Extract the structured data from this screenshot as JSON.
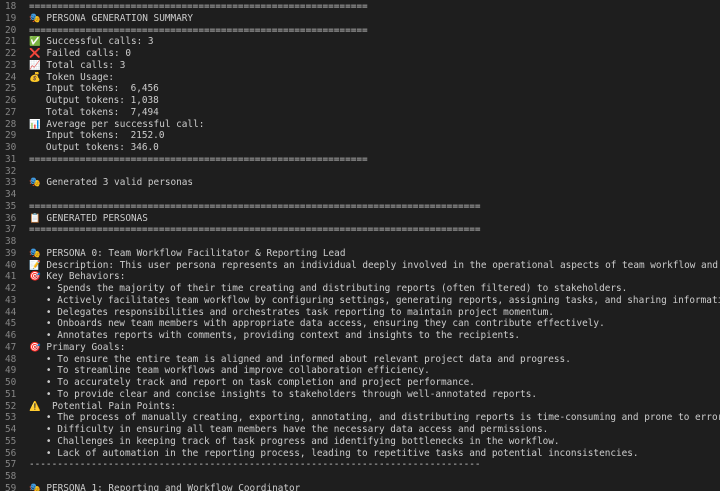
{
  "lines": [
    {
      "n": "18",
      "t": "============================================================"
    },
    {
      "n": "19",
      "t": "🎭 PERSONA GENERATION SUMMARY"
    },
    {
      "n": "20",
      "t": "============================================================"
    },
    {
      "n": "21",
      "t": "✅ Successful calls: 3"
    },
    {
      "n": "22",
      "t": "❌ Failed calls: 0"
    },
    {
      "n": "23",
      "t": "📈 Total calls: 3"
    },
    {
      "n": "24",
      "t": "💰 Token Usage:"
    },
    {
      "n": "25",
      "t": "   Input tokens:  6,456"
    },
    {
      "n": "26",
      "t": "   Output tokens: 1,038"
    },
    {
      "n": "27",
      "t": "   Total tokens:  7,494"
    },
    {
      "n": "28",
      "t": "📊 Average per successful call:"
    },
    {
      "n": "29",
      "t": "   Input tokens:  2152.0"
    },
    {
      "n": "30",
      "t": "   Output tokens: 346.0"
    },
    {
      "n": "31",
      "t": "============================================================"
    },
    {
      "n": "32",
      "t": ""
    },
    {
      "n": "33",
      "t": "🎭 Generated 3 valid personas"
    },
    {
      "n": "34",
      "t": ""
    },
    {
      "n": "35",
      "t": "================================================================================"
    },
    {
      "n": "36",
      "t": "📋 GENERATED PERSONAS"
    },
    {
      "n": "37",
      "t": "================================================================================"
    },
    {
      "n": "38",
      "t": ""
    },
    {
      "n": "39",
      "t": "🎭 PERSONA 0: Team Workflow Facilitator & Reporting Lead"
    },
    {
      "n": "40",
      "t": "📝 Description: This user persona represents an individual deeply involved in the operational aspects of team workflow and reporting."
    },
    {
      "n": "41",
      "t": "🎯 Key Behaviors:"
    },
    {
      "n": "42",
      "t": "   • Spends the majority of their time creating and distributing reports (often filtered) to stakeholders."
    },
    {
      "n": "43",
      "t": "   • Actively facilitates team workflow by configuring settings, generating reports, assigning tasks, and sharing information."
    },
    {
      "n": "44",
      "t": "   • Delegates responsibilities and orchestrates task reporting to maintain project momentum."
    },
    {
      "n": "45",
      "t": "   • Onboards new team members with appropriate data access, ensuring they can contribute effectively."
    },
    {
      "n": "46",
      "t": "   • Annotates reports with comments, providing context and insights to the recipients."
    },
    {
      "n": "47",
      "t": "🎯 Primary Goals:"
    },
    {
      "n": "48",
      "t": "   • To ensure the entire team is aligned and informed about relevant project data and progress."
    },
    {
      "n": "49",
      "t": "   • To streamline team workflows and improve collaboration efficiency."
    },
    {
      "n": "50",
      "t": "   • To accurately track and report on task completion and project performance."
    },
    {
      "n": "51",
      "t": "   • To provide clear and concise insights to stakeholders through well-annotated reports."
    },
    {
      "n": "52",
      "t": "⚠️  Potential Pain Points:"
    },
    {
      "n": "53",
      "t": "   • The process of manually creating, exporting, annotating, and distributing reports is time-consuming and prone to error."
    },
    {
      "n": "54",
      "t": "   • Difficulty in ensuring all team members have the necessary data access and permissions."
    },
    {
      "n": "55",
      "t": "   • Challenges in keeping track of task progress and identifying bottlenecks in the workflow."
    },
    {
      "n": "56",
      "t": "   • Lack of automation in the reporting process, leading to repetitive tasks and potential inconsistencies."
    },
    {
      "n": "57",
      "t": "--------------------------------------------------------------------------------"
    },
    {
      "n": "58",
      "t": ""
    },
    {
      "n": "59",
      "t": "🎭 PERSONA 1: Reporting and Workflow Coordinator"
    }
  ]
}
